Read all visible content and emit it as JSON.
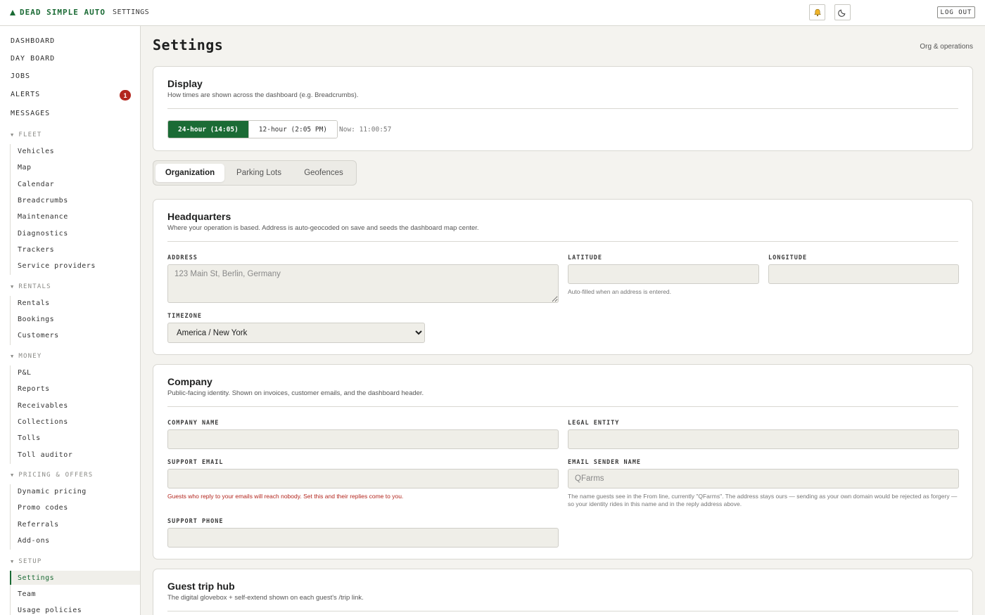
{
  "app": {
    "brand": "DEAD SIMPLE AUTO",
    "breadcrumb": "SETTINGS",
    "logout_label": "LOG OUT"
  },
  "sidebar": {
    "top_items": [
      {
        "label": "DASHBOARD"
      },
      {
        "label": "DAY BOARD"
      },
      {
        "label": "JOBS"
      },
      {
        "label": "ALERTS",
        "badge": "1"
      },
      {
        "label": "MESSAGES"
      }
    ],
    "sections": [
      {
        "title": "FLEET",
        "items": [
          "Vehicles",
          "Map",
          "Calendar",
          "Breadcrumbs",
          "Maintenance",
          "Diagnostics",
          "Trackers",
          "Service providers"
        ]
      },
      {
        "title": "RENTALS",
        "items": [
          "Rentals",
          "Bookings",
          "Customers"
        ]
      },
      {
        "title": "MONEY",
        "items": [
          "P&L",
          "Reports",
          "Receivables",
          "Collections",
          "Tolls",
          "Toll auditor"
        ]
      },
      {
        "title": "PRICING & OFFERS",
        "items": [
          "Dynamic pricing",
          "Promo codes",
          "Referrals",
          "Add-ons"
        ]
      },
      {
        "title": "SETUP",
        "items": [
          "Settings",
          "Team",
          "Usage policies"
        ]
      }
    ],
    "active_item": "Settings"
  },
  "page": {
    "title": "Settings",
    "subtitle": "Org & operations"
  },
  "display_card": {
    "title": "Display",
    "description": "How times are shown across the dashboard (e.g. Breadcrumbs).",
    "option_24h": "24-hour (14:05)",
    "option_12h": "12-hour (2:05 PM)",
    "selected": "24-hour",
    "now_label": "Now: 11:00:57"
  },
  "tabs": {
    "organization": "Organization",
    "parking_lots": "Parking Lots",
    "geofences": "Geofences",
    "active": "Organization"
  },
  "hq_card": {
    "title": "Headquarters",
    "description": "Where your operation is based. Address is auto-geocoded on save and seeds the dashboard map center.",
    "address_label": "ADDRESS",
    "address_placeholder": "123 Main St, Berlin, Germany",
    "latitude_label": "LATITUDE",
    "latitude_hint": "Auto-filled when an address is entered.",
    "longitude_label": "LONGITUDE",
    "timezone_label": "TIMEZONE",
    "timezone_value": "America / New York"
  },
  "company_card": {
    "title": "Company",
    "description": "Public-facing identity. Shown on invoices, customer emails, and the dashboard header.",
    "company_name_label": "COMPANY NAME",
    "legal_entity_label": "LEGAL ENTITY",
    "support_email_label": "SUPPORT EMAIL",
    "support_email_error": "Guests who reply to your emails will reach nobody. Set this and their replies come to you.",
    "sender_name_label": "EMAIL SENDER NAME",
    "sender_name_placeholder": "QFarms",
    "sender_name_hint": "The name guests see in the From line, currently \"QFarms\". The address stays ours — sending as your own domain would be rejected as forgery — so your identity rides in this name and in the reply address above.",
    "support_phone_label": "SUPPORT PHONE"
  },
  "guest_card": {
    "title": "Guest trip hub",
    "description": "The digital glovebox + self-extend shown on each guest's /trip link."
  },
  "colors": {
    "accent": "#1b6b35",
    "error": "#b3261e",
    "background": "#f4f3ef"
  }
}
